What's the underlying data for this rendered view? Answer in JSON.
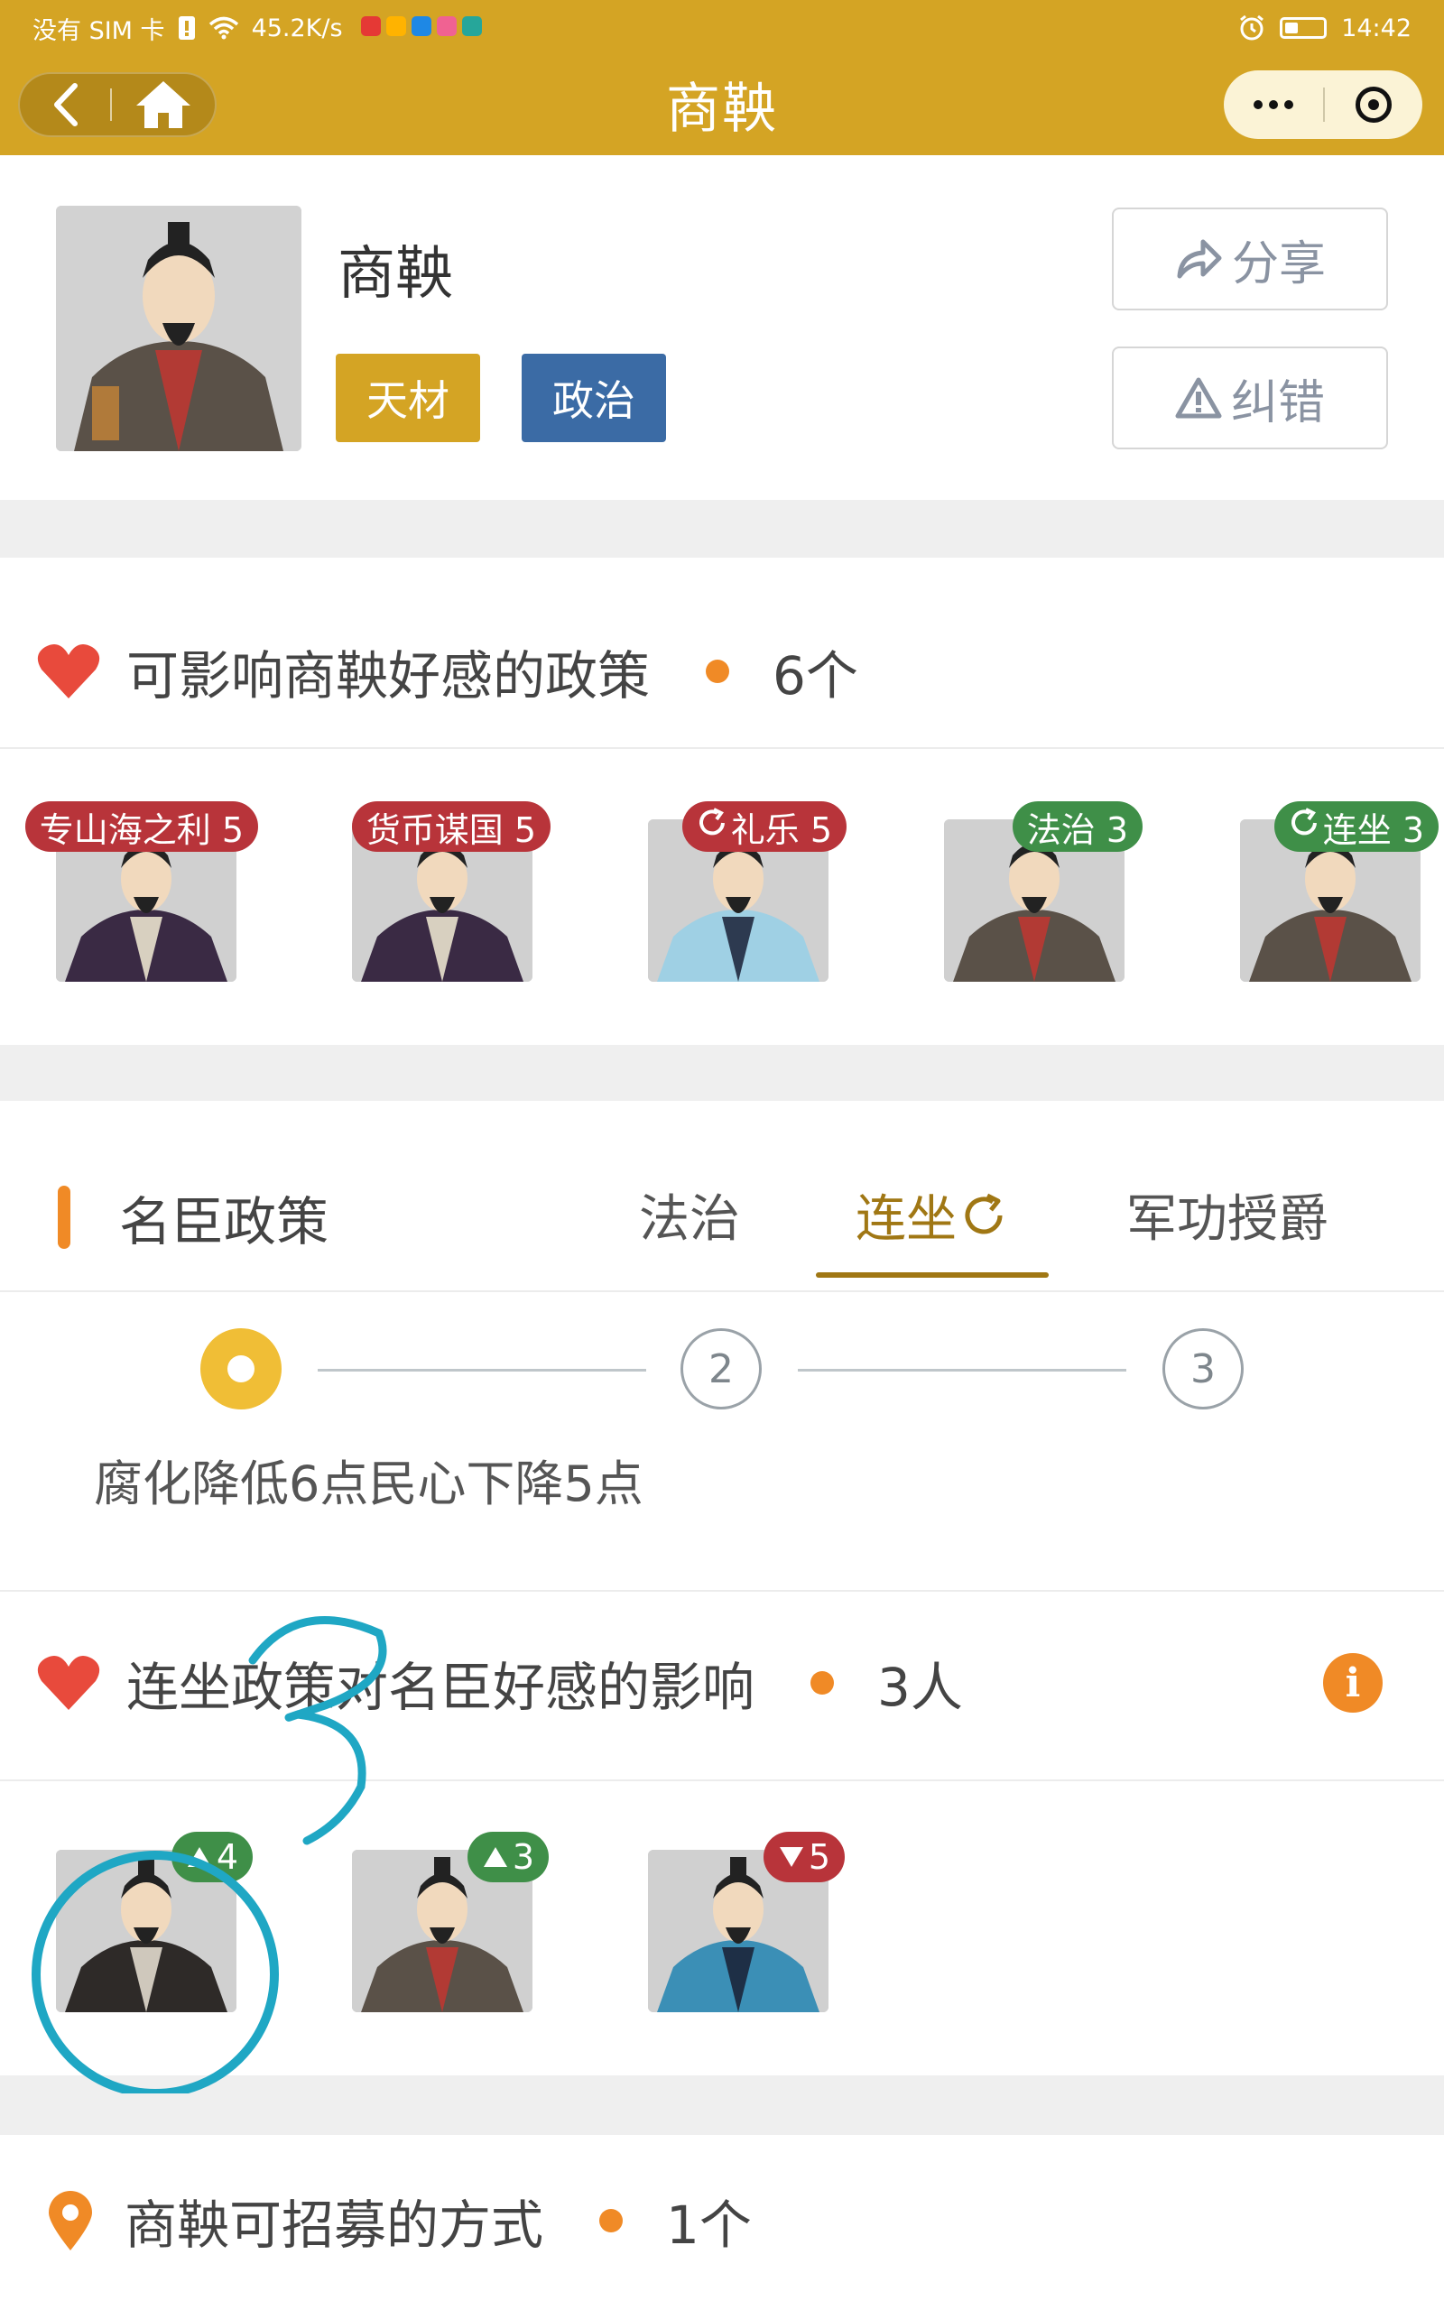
{
  "status_bar": {
    "carrier": "没有 SIM 卡",
    "speed": "45.2K/s",
    "time": "14:42",
    "mini_app_colors": [
      "#e53935",
      "#ffb300",
      "#1e88e5",
      "#f06292",
      "#26a69a"
    ]
  },
  "nav": {
    "title": "商鞅",
    "back_icon": "chevron-left-icon",
    "home_icon": "home-icon",
    "more_icon": "more-dots-icon",
    "close_icon": "target-icon"
  },
  "profile": {
    "name": "商鞅",
    "tags": [
      "天材",
      "政治"
    ],
    "share_label": "分享",
    "report_label": "纠错",
    "colors": {
      "gold": "#d4a424",
      "blue": "#3b6ba5"
    }
  },
  "policies": {
    "title": "可影响商鞅好感的政策",
    "count": "6个",
    "items": [
      {
        "label": "专山海之利 5",
        "color": "red",
        "refresh": false
      },
      {
        "label": "货币谋国 5",
        "color": "red",
        "refresh": false
      },
      {
        "label": "礼乐 5",
        "color": "red",
        "refresh": true
      },
      {
        "label": "法治 3",
        "color": "green",
        "refresh": false
      },
      {
        "label": "连坐 3",
        "color": "green",
        "refresh": true
      }
    ]
  },
  "minister_policy": {
    "title": "名臣政策",
    "tabs": [
      "法治",
      "连坐",
      "军功授爵"
    ],
    "active_tab": "连坐",
    "steps": [
      "1",
      "2",
      "3"
    ],
    "active_step": 1,
    "description": "腐化降低6点民心下降5点",
    "influence_title": "连坐政策对名臣好感的影响",
    "influence_count": "3人",
    "influence_items": [
      {
        "delta": "4",
        "direction": "up"
      },
      {
        "delta": "3",
        "direction": "up"
      },
      {
        "delta": "5",
        "direction": "down"
      }
    ]
  },
  "recruit": {
    "title": "商鞅可招募的方式",
    "count": "1个"
  }
}
